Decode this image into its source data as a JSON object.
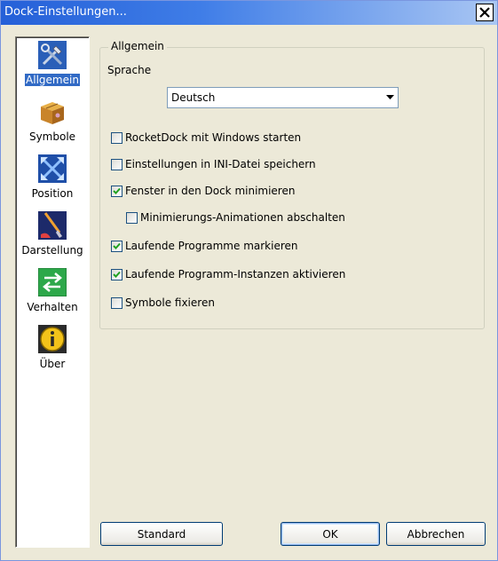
{
  "window": {
    "title": "Dock-Einstellungen..."
  },
  "sidebar": {
    "items": [
      {
        "label": "Allgemein",
        "icon": "tools-icon",
        "selected": true
      },
      {
        "label": "Symbole",
        "icon": "box-icon"
      },
      {
        "label": "Position",
        "icon": "arrows-icon"
      },
      {
        "label": "Darstellung",
        "icon": "brush-icon"
      },
      {
        "label": "Verhalten",
        "icon": "swap-icon"
      },
      {
        "label": "Über",
        "icon": "info-icon"
      }
    ]
  },
  "general": {
    "legend": "Allgemein",
    "language_label": "Sprache",
    "language_value": "Deutsch",
    "options": [
      {
        "label": "RocketDock mit Windows starten",
        "checked": false
      },
      {
        "label": "Einstellungen in INI-Datei speichern",
        "checked": false
      },
      {
        "label": "Fenster in den Dock minimieren",
        "checked": true
      },
      {
        "label": "Minimierungs-Animationen abschalten",
        "checked": false
      },
      {
        "label": "Laufende Programme markieren",
        "checked": true
      },
      {
        "label": "Laufende Programm-Instanzen aktivieren",
        "checked": true
      },
      {
        "label": "Symbole fixieren",
        "checked": false
      }
    ]
  },
  "buttons": {
    "standard": "Standard",
    "ok": "OK",
    "cancel": "Abbrechen"
  },
  "colors": {
    "titlebar": "#2560D8",
    "selection": "#316AC5",
    "face": "#ECE9D8",
    "check": "#21A121"
  }
}
